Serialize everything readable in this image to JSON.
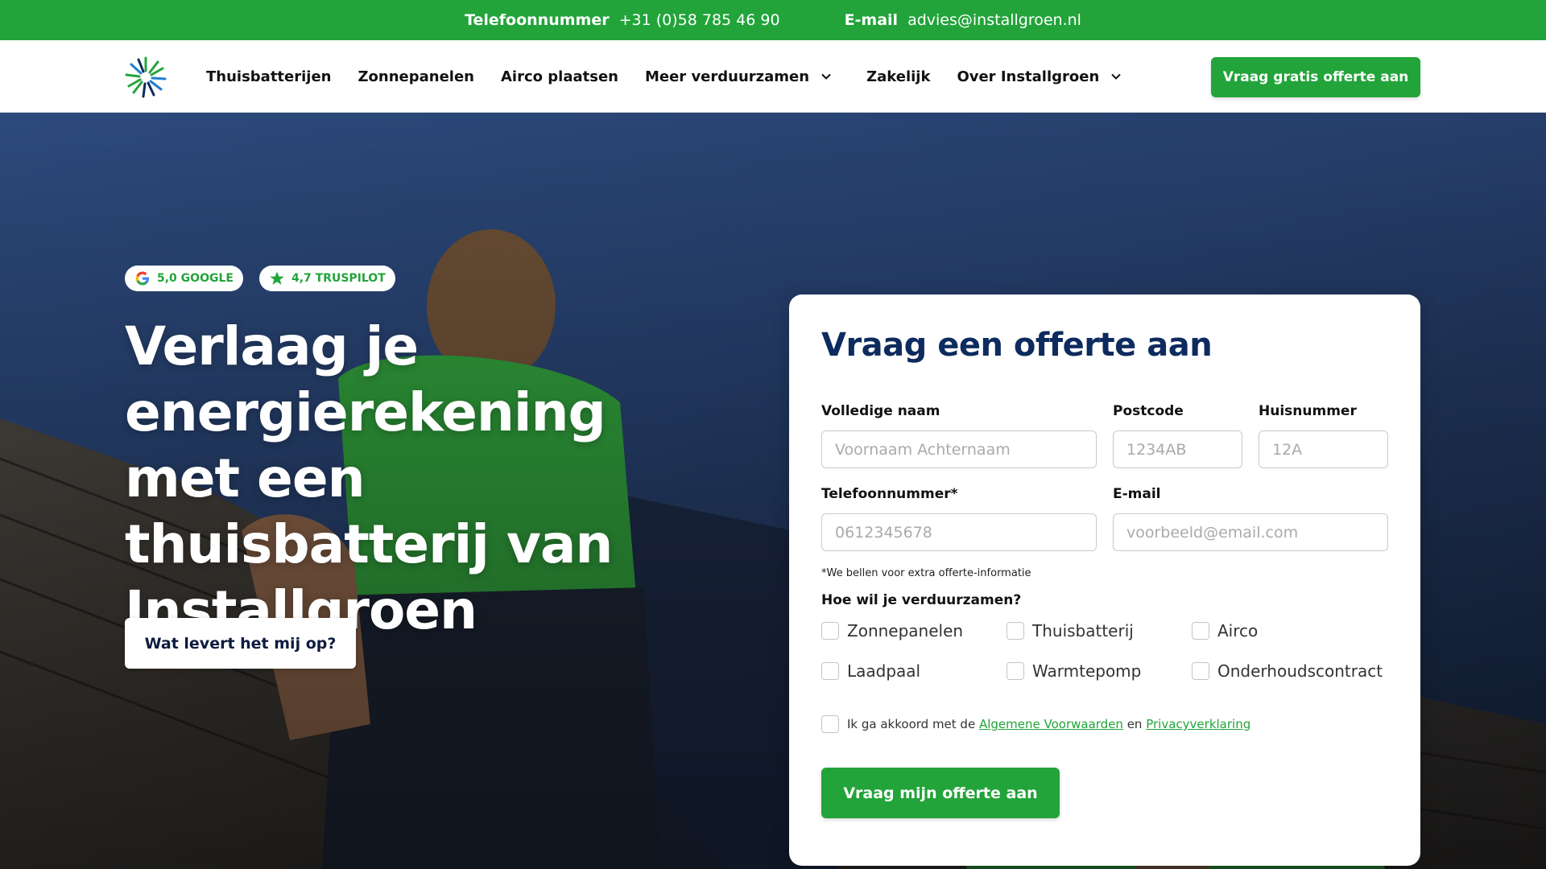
{
  "topbar": {
    "phone_label": "Telefoonnummer",
    "phone_value": "+31 (0)58 785 46 90",
    "email_label": "E-mail",
    "email_value": "advies@installgroen.nl"
  },
  "nav": {
    "items": [
      {
        "label": "Thuisbatterijen"
      },
      {
        "label": "Zonnepanelen"
      },
      {
        "label": "Airco plaatsen"
      },
      {
        "label": "Meer verduurzamen",
        "dropdown": true
      },
      {
        "label": "Zakelijk"
      },
      {
        "label": "Over Installgroen",
        "dropdown": true
      }
    ],
    "cta": "Vraag gratis offerte aan"
  },
  "hero": {
    "badges": [
      {
        "icon": "google-icon",
        "text": "5,0 GOOGLE"
      },
      {
        "icon": "star-icon",
        "text": "4,7 TRUSPILOT"
      }
    ],
    "title": "Verlaag je energierekening met een thuisbatterij van Installgroen",
    "button": "Wat levert het mij op?"
  },
  "form": {
    "title": "Vraag een offerte aan",
    "fields": {
      "name": {
        "label": "Volledige naam",
        "placeholder": "Voornaam Achternaam"
      },
      "postcode": {
        "label": "Postcode",
        "placeholder": "1234AB"
      },
      "housenumber": {
        "label": "Huisnummer",
        "placeholder": "12A"
      },
      "phone": {
        "label": "Telefoonnummer*",
        "placeholder": "0612345678"
      },
      "email": {
        "label": "E-mail",
        "placeholder": "voorbeeld@email.com"
      }
    },
    "note": "*We bellen voor extra offerte-informatie",
    "question": "Hoe wil je verduurzamen?",
    "options": [
      "Zonnepanelen",
      "Thuisbatterij",
      "Airco",
      "Laadpaal",
      "Warmtepomp",
      "Onderhoudscontract"
    ],
    "agree_prefix": "Ik ga akkoord met de",
    "agree_link1": "Algemene Voorwaarden",
    "agree_mid": "en",
    "agree_link2": "Privacyverklaring",
    "submit": "Vraag mijn offerte aan"
  },
  "colors": {
    "brand_green": "#22a43a",
    "navy": "#0d2b5e",
    "hero_blue": "#263f6c"
  }
}
